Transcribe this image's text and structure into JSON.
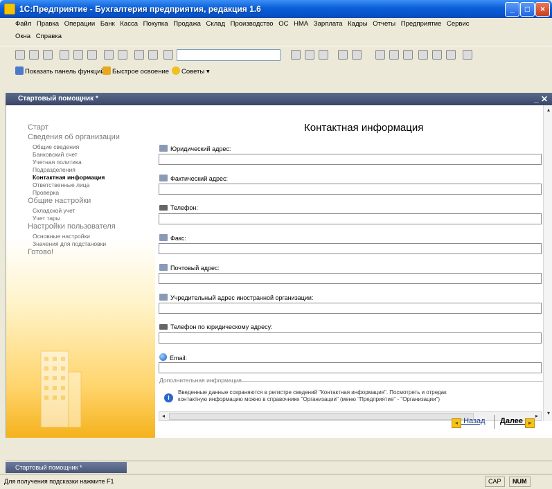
{
  "window": {
    "title": "1С:Предприятие - Бухгалтерия предприятия, редакция 1.6",
    "controls": {
      "minimize": "_",
      "maximize": "□",
      "close": "×"
    }
  },
  "menu": {
    "row1": [
      "Файл",
      "Правка",
      "Операции",
      "Банк",
      "Касса",
      "Покупка",
      "Продажа",
      "Склад",
      "Производство",
      "ОС",
      "НМА",
      "Зарплата",
      "Кадры",
      "Отчеты",
      "Предприятие",
      "Сервис"
    ],
    "row2": [
      "Окна",
      "Справка"
    ]
  },
  "toolbar2": {
    "functions_panel": "Показать панель функций",
    "quick_start": "Быстрое освоение",
    "tips": "Советы"
  },
  "inner_window": {
    "title": "Стартовый помощник *",
    "controls": "_ ✕"
  },
  "sidebar": {
    "items": [
      {
        "label": "Старт",
        "level": 1,
        "active": false
      },
      {
        "label": "Сведения об организации",
        "level": 1,
        "active": false
      },
      {
        "label": "Общие сведения",
        "level": 2,
        "active": false
      },
      {
        "label": "Банковский счет",
        "level": 2,
        "active": false
      },
      {
        "label": "Учетная политика",
        "level": 2,
        "active": false
      },
      {
        "label": "Подразделения",
        "level": 2,
        "active": false
      },
      {
        "label": "Контактная информация",
        "level": 2,
        "active": true
      },
      {
        "label": "Ответственные лица",
        "level": 2,
        "active": false
      },
      {
        "label": "Проверка",
        "level": 2,
        "active": false
      },
      {
        "label": "Общие настройки",
        "level": 1,
        "active": false
      },
      {
        "label": "Складской учет",
        "level": 2,
        "active": false
      },
      {
        "label": "Учет тары",
        "level": 2,
        "active": false
      },
      {
        "label": "Настройки пользователя",
        "level": 1,
        "active": false
      },
      {
        "label": "Основные настройки",
        "level": 2,
        "active": false
      },
      {
        "label": "Значения для подстановки",
        "level": 2,
        "active": false
      },
      {
        "label": "Готово!",
        "level": 1,
        "active": false
      }
    ]
  },
  "content": {
    "title": "Контактная информация",
    "fields": [
      {
        "label": "Юридический адрес:",
        "value": ""
      },
      {
        "label": "Фактический адрес:",
        "value": ""
      },
      {
        "label": "Телефон:",
        "value": ""
      },
      {
        "label": "Факс:",
        "value": ""
      },
      {
        "label": "Почтовый адрес:",
        "value": ""
      },
      {
        "label": "Учредительный адрес иностранной организации:",
        "value": ""
      },
      {
        "label": "Телефон по юридическому адресу:",
        "value": ""
      },
      {
        "label": "Email:",
        "value": ""
      }
    ],
    "additional_info_label": "Дополнительная информация",
    "info_line1": "Введенные данные сохраняются в регистре сведений \"Контактная информация\". Посмотреть и отредак",
    "info_line2": "контактную информацию можно в справочнике \"Организации\" (меню \"Предприятие\" - \"Организации\")"
  },
  "nav": {
    "back": "Назад",
    "next": "Далее"
  },
  "taskbar": {
    "tab": "Стартовый помощник *"
  },
  "statusbar": {
    "hint": "Для получения подсказки нажмите F1",
    "cap": "CAP",
    "num": "NUM"
  }
}
